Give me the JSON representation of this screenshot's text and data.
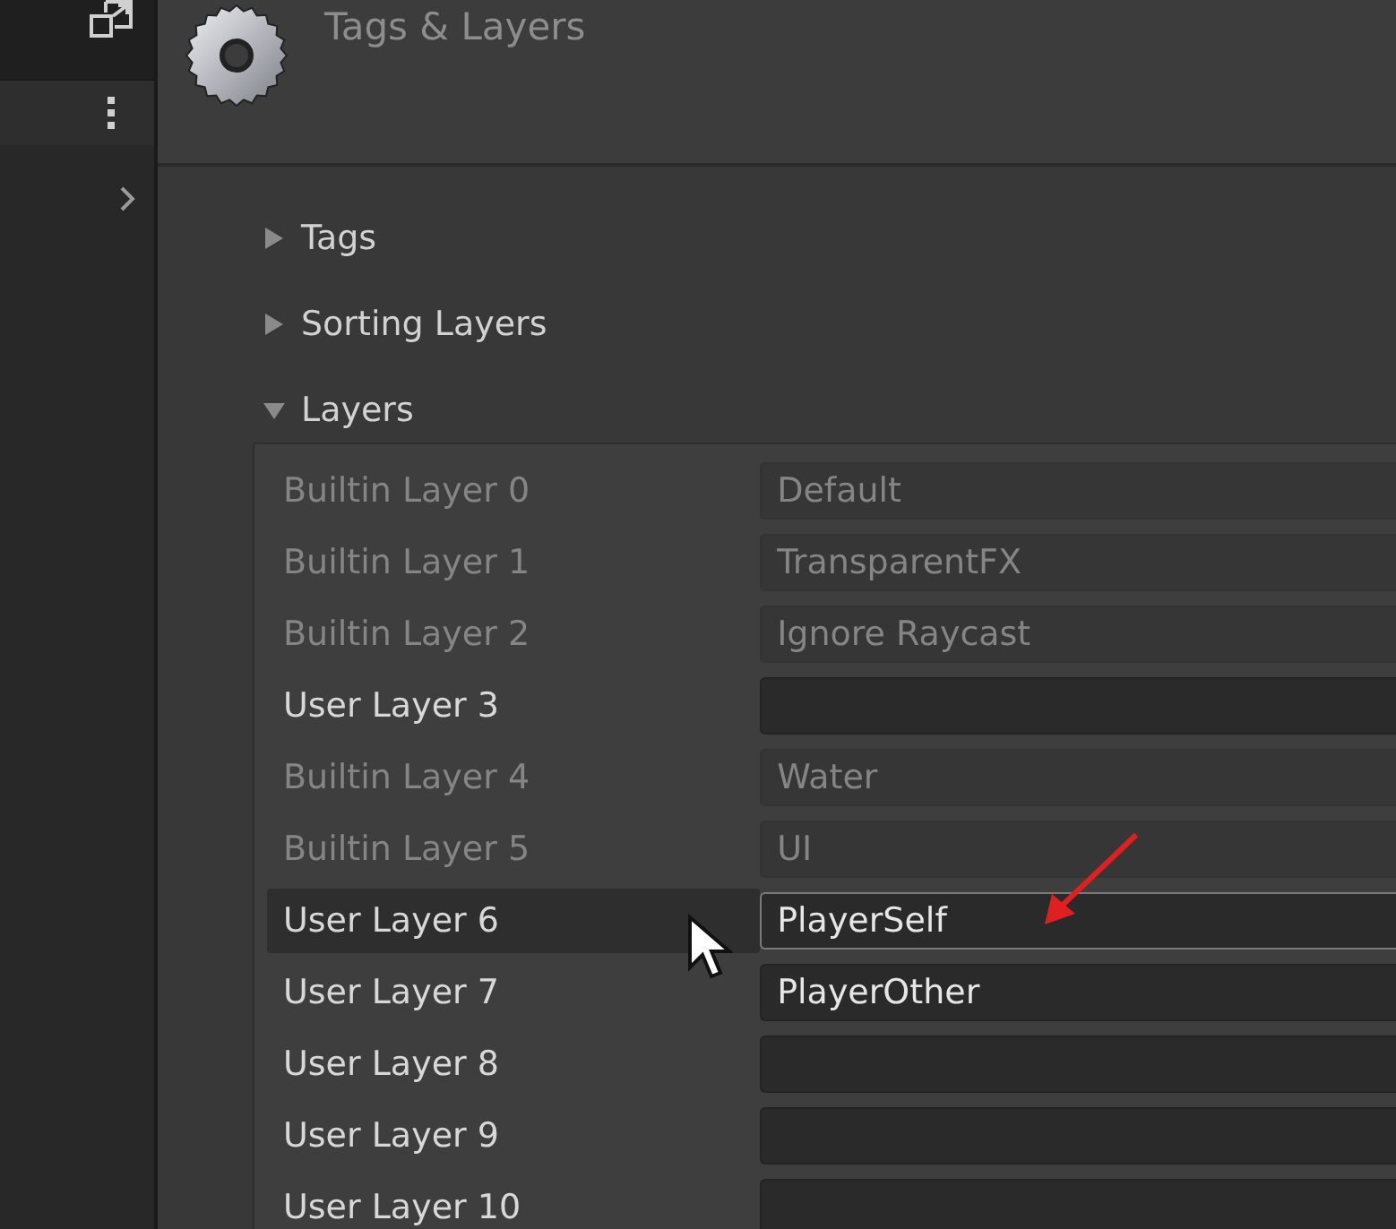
{
  "inspector": {
    "title": "Tags & Layers"
  },
  "sections": [
    {
      "label": "Tags",
      "expanded": false
    },
    {
      "label": "Sorting Layers",
      "expanded": false
    },
    {
      "label": "Layers",
      "expanded": true
    }
  ],
  "layers": [
    {
      "label": "Builtin Layer 0",
      "value": "Default",
      "editable": false,
      "selected": false,
      "focused": false
    },
    {
      "label": "Builtin Layer 1",
      "value": "TransparentFX",
      "editable": false,
      "selected": false,
      "focused": false
    },
    {
      "label": "Builtin Layer 2",
      "value": "Ignore Raycast",
      "editable": false,
      "selected": false,
      "focused": false
    },
    {
      "label": "User Layer 3",
      "editable": true,
      "selected": false,
      "focused": false
    },
    {
      "label": "Builtin Layer 4",
      "value": "Water",
      "editable": false,
      "selected": false,
      "focused": false
    },
    {
      "label": "Builtin Layer 5",
      "value": "UI",
      "editable": false,
      "selected": false,
      "focused": false
    },
    {
      "label": "User Layer 6",
      "value": "PlayerSelf",
      "editable": true,
      "selected": true,
      "focused": true
    },
    {
      "label": "User Layer 7",
      "value": "PlayerOther",
      "editable": true,
      "selected": false,
      "focused": false
    },
    {
      "label": "User Layer 8",
      "editable": true,
      "selected": false,
      "focused": false
    },
    {
      "label": "User Layer 9",
      "editable": true,
      "selected": false,
      "focused": false
    },
    {
      "label": "User Layer 10",
      "editable": true,
      "selected": false,
      "focused": false
    }
  ]
}
